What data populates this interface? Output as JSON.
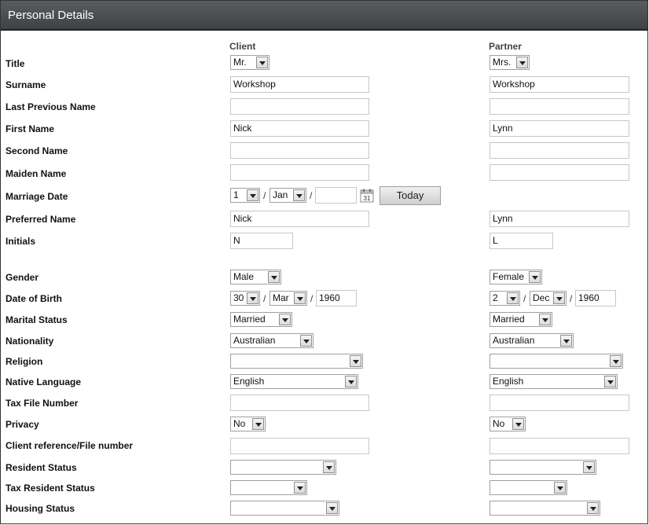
{
  "panel": {
    "title": "Personal Details"
  },
  "columns": {
    "client": "Client",
    "partner": "Partner"
  },
  "labels": {
    "title": "Title",
    "surname": "Surname",
    "last_previous_name": "Last Previous Name",
    "first_name": "First Name",
    "second_name": "Second Name",
    "maiden_name": "Maiden Name",
    "marriage_date": "Marriage Date",
    "preferred_name": "Preferred Name",
    "initials": "Initials",
    "gender": "Gender",
    "date_of_birth": "Date of Birth",
    "marital_status": "Marital Status",
    "nationality": "Nationality",
    "religion": "Religion",
    "native_language": "Native Language",
    "tax_file_number": "Tax File Number",
    "privacy": "Privacy",
    "client_reference": "Client reference/File number",
    "resident_status": "Resident Status",
    "tax_resident_status": "Tax Resident Status",
    "housing_status": "Housing Status"
  },
  "client": {
    "title": "Mr.",
    "surname": "Workshop",
    "last_previous_name": "",
    "first_name": "Nick",
    "second_name": "",
    "maiden_name": "",
    "marriage_day": "1",
    "marriage_month": "Jan",
    "marriage_year": "",
    "preferred_name": "Nick",
    "initials": "N",
    "gender": "Male",
    "dob_day": "30",
    "dob_month": "Mar",
    "dob_year": "1960",
    "marital_status": "Married",
    "nationality": "Australian",
    "religion": "",
    "native_language": "English",
    "tax_file_number": "",
    "privacy": "No",
    "client_reference": "",
    "resident_status": "",
    "tax_resident_status": "",
    "housing_status": ""
  },
  "partner": {
    "title": "Mrs.",
    "surname": "Workshop",
    "last_previous_name": "",
    "first_name": "Lynn",
    "second_name": "",
    "maiden_name": "",
    "preferred_name": "Lynn",
    "initials": "L",
    "gender": "Female",
    "dob_day": "2",
    "dob_month": "Dec",
    "dob_year": "1960",
    "marital_status": "Married",
    "nationality": "Australian",
    "religion": "",
    "native_language": "English",
    "tax_file_number": "",
    "privacy": "No",
    "client_reference": "",
    "resident_status": "",
    "tax_resident_status": "",
    "housing_status": ""
  },
  "date_separator": "/",
  "buttons": {
    "today": "Today"
  },
  "icons": {
    "calendar": "calendar-icon",
    "dropdown": "chevron-down-icon"
  }
}
